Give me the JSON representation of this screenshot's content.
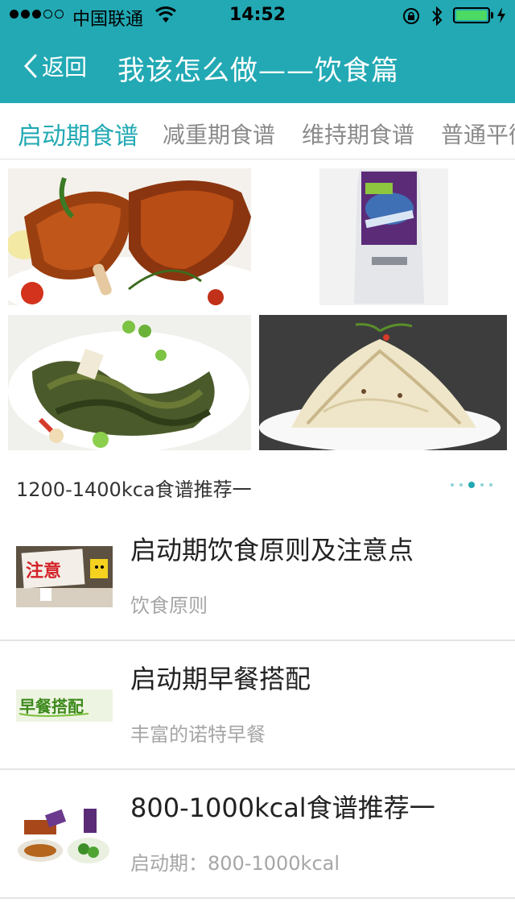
{
  "status_bar": {
    "carrier": "中国联通",
    "time": "14:52"
  },
  "navbar": {
    "back_label": "返回",
    "title": "我该怎么做——饮食篇"
  },
  "tabs": [
    {
      "label": "启动期食谱",
      "active": true
    },
    {
      "label": "减重期食谱",
      "active": false
    },
    {
      "label": "维持期食谱",
      "active": false
    },
    {
      "label": "普通平衡",
      "active": false
    }
  ],
  "carousel": {
    "caption": "1200-1400kca食谱推荐一",
    "page_count": 5,
    "current_page": 3,
    "images": [
      "roast-chicken-legs",
      "protein-shake-packet",
      "stir-fried-kelp",
      "bean-sprouts-salad"
    ]
  },
  "list": [
    {
      "title": "启动期饮食原则及注意点",
      "subtitle": "饮食原则",
      "thumb": "notice-sign",
      "thumb_text": "注意"
    },
    {
      "title": "启动期早餐搭配",
      "subtitle": "丰富的诺特早餐",
      "thumb": "breakfast-banner",
      "thumb_text": "早餐搭配"
    },
    {
      "title": "800-1000kcal食谱推荐一",
      "subtitle": "启动期：800-1000kcal",
      "thumb": "meal-collage"
    }
  ],
  "colors": {
    "accent": "#22a9b4",
    "text": "#222222",
    "muted": "#a6a6a6"
  }
}
